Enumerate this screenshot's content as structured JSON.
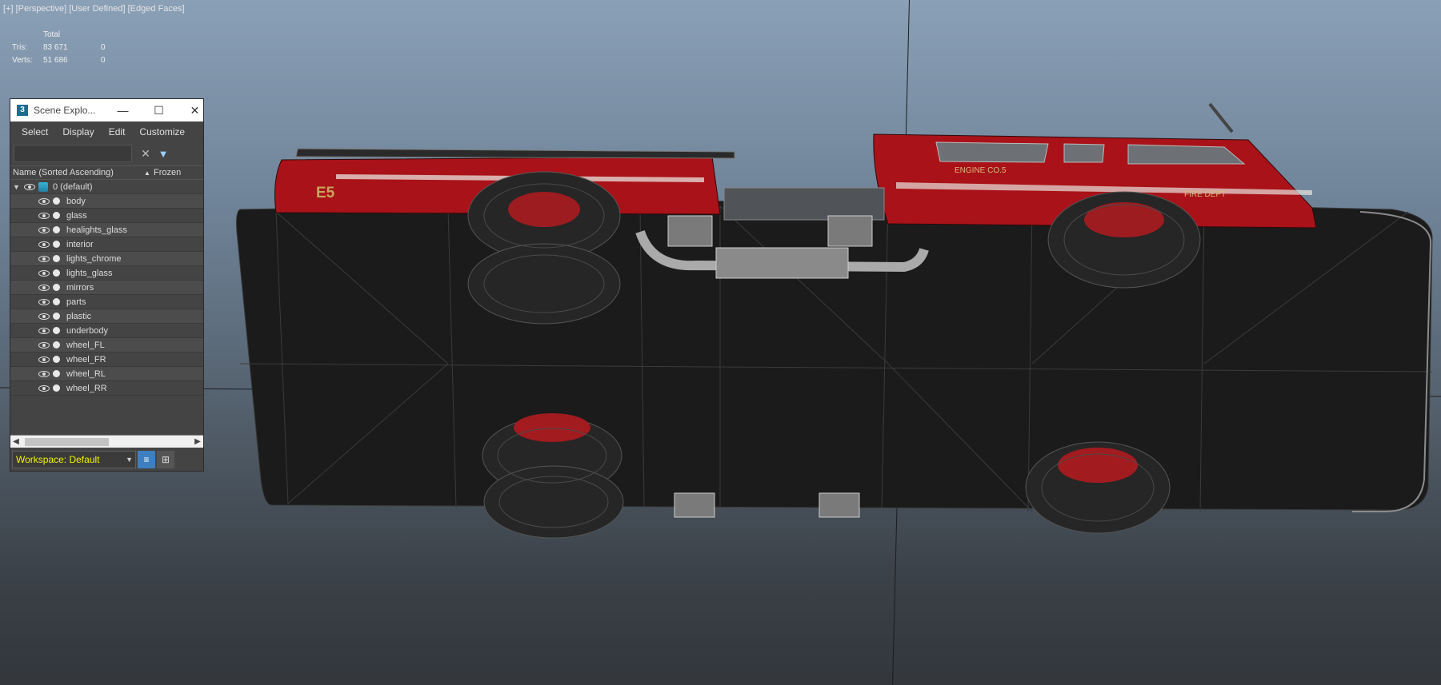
{
  "viewport": {
    "label": "[+] [Perspective] [User Defined] [Edged Faces]",
    "stats": {
      "header": "Total",
      "rows": [
        {
          "label": "Tris:",
          "total": "83 671",
          "selected": "0"
        },
        {
          "label": "Verts:",
          "total": "51 686",
          "selected": "0"
        }
      ]
    },
    "truck_decals": {
      "unit": "E5",
      "door": "ENGINE CO.5",
      "body": "FIRE DEPT"
    }
  },
  "explorer": {
    "title": "Scene Explo...",
    "app_icon": "3",
    "window_controls": {
      "minimize": "—",
      "maximize": "☐",
      "close": "✕"
    },
    "menu": [
      "Select",
      "Display",
      "Edit",
      "Customize"
    ],
    "search": {
      "value": "",
      "placeholder": ""
    },
    "columns": {
      "name": "Name (Sorted Ascending)",
      "sort_icon": "▲",
      "frozen": "Frozen"
    },
    "layer": "0 (default)",
    "objects": [
      "body",
      "glass",
      "healights_glass",
      "interior",
      "lights_chrome",
      "lights_glass",
      "mirrors",
      "parts",
      "plastic",
      "underbody",
      "wheel_FL",
      "wheel_FR",
      "wheel_RL",
      "wheel_RR"
    ],
    "workspace": "Workspace: Default"
  },
  "colors": {
    "accent": "#3d7fc0",
    "workspace_text": "#f4f400",
    "truck_red": "#b3131a"
  }
}
